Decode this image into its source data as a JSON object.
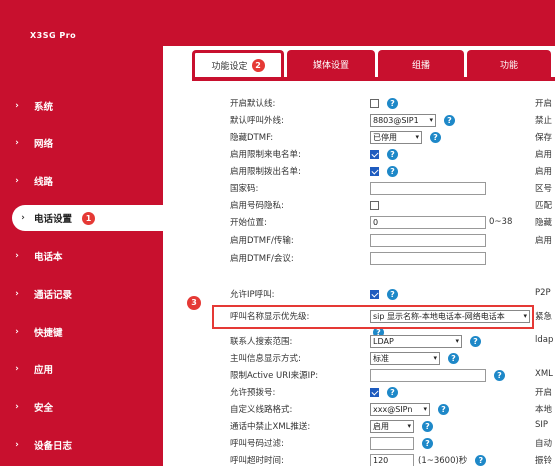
{
  "brand": {
    "logo": "X3SG Pro"
  },
  "sidebar": {
    "items": [
      {
        "label": "系统"
      },
      {
        "label": "网络"
      },
      {
        "label": "线路"
      },
      {
        "label": "电话设置",
        "badge": "1"
      },
      {
        "label": "电话本"
      },
      {
        "label": "通话记录"
      },
      {
        "label": "快捷键"
      },
      {
        "label": "应用"
      },
      {
        "label": "安全"
      },
      {
        "label": "设备日志"
      }
    ]
  },
  "tabs": [
    {
      "label": "功能设定",
      "badge": "2"
    },
    {
      "label": "媒体设置"
    },
    {
      "label": "组播"
    },
    {
      "label": "功能"
    }
  ],
  "annotation_marker": "3",
  "settings": {
    "r1": {
      "label": "开启默认线:"
    },
    "r2": {
      "label": "默认呼叫外线:",
      "value": "8803@SIP1"
    },
    "r3": {
      "label": "隐藏DTMF:",
      "value": "已停用"
    },
    "r4": {
      "label": "启用限制来电名单:"
    },
    "r5": {
      "label": "启用限制拨出名单:"
    },
    "r6": {
      "label": "国家码:"
    },
    "r7": {
      "label": "启用号码隐私:"
    },
    "r8": {
      "label": "开始位置:",
      "value": "0",
      "range": "0~38"
    },
    "r9": {
      "label": "启用DTMF/传输:"
    },
    "r10": {
      "label": "启用DTMF/会议:"
    },
    "r11": {
      "label": "允许IP呼叫:"
    },
    "r12": {
      "label": "呼叫名称显示优先级:",
      "value": "sip 显示名称-本地电话本-网络电话本"
    },
    "r13": {
      "label": "联系人搜索范围:",
      "value": "LDAP"
    },
    "r14": {
      "label": "主叫信息显示方式:",
      "value": "标准"
    },
    "r15": {
      "label": "限制Active URI来源IP:"
    },
    "r16": {
      "label": "允许预拨号:"
    },
    "r17": {
      "label": "自定义线路格式:",
      "value": "xxx@SIPn"
    },
    "r18": {
      "label": "通话中禁止XML推送:",
      "value": "启用"
    },
    "r19": {
      "label": "呼叫号码过滤:"
    },
    "r20": {
      "label": "呼叫超时时间:",
      "value": "120",
      "range": "(1~3600)秒"
    }
  },
  "right_column": {
    "r1": "开启",
    "r2": "禁止",
    "r3": "保存",
    "r4": "启用",
    "r5": "启用",
    "r6": "区号",
    "r7": "匹配",
    "r8": "隐藏",
    "r9": "启用",
    "r11": "P2P",
    "r12": "紧急",
    "r13": "ldap",
    "r15": "XML",
    "r16": "开启",
    "r17": "本地",
    "r18": "SIP",
    "r19": "自动",
    "r20": "振铃"
  }
}
